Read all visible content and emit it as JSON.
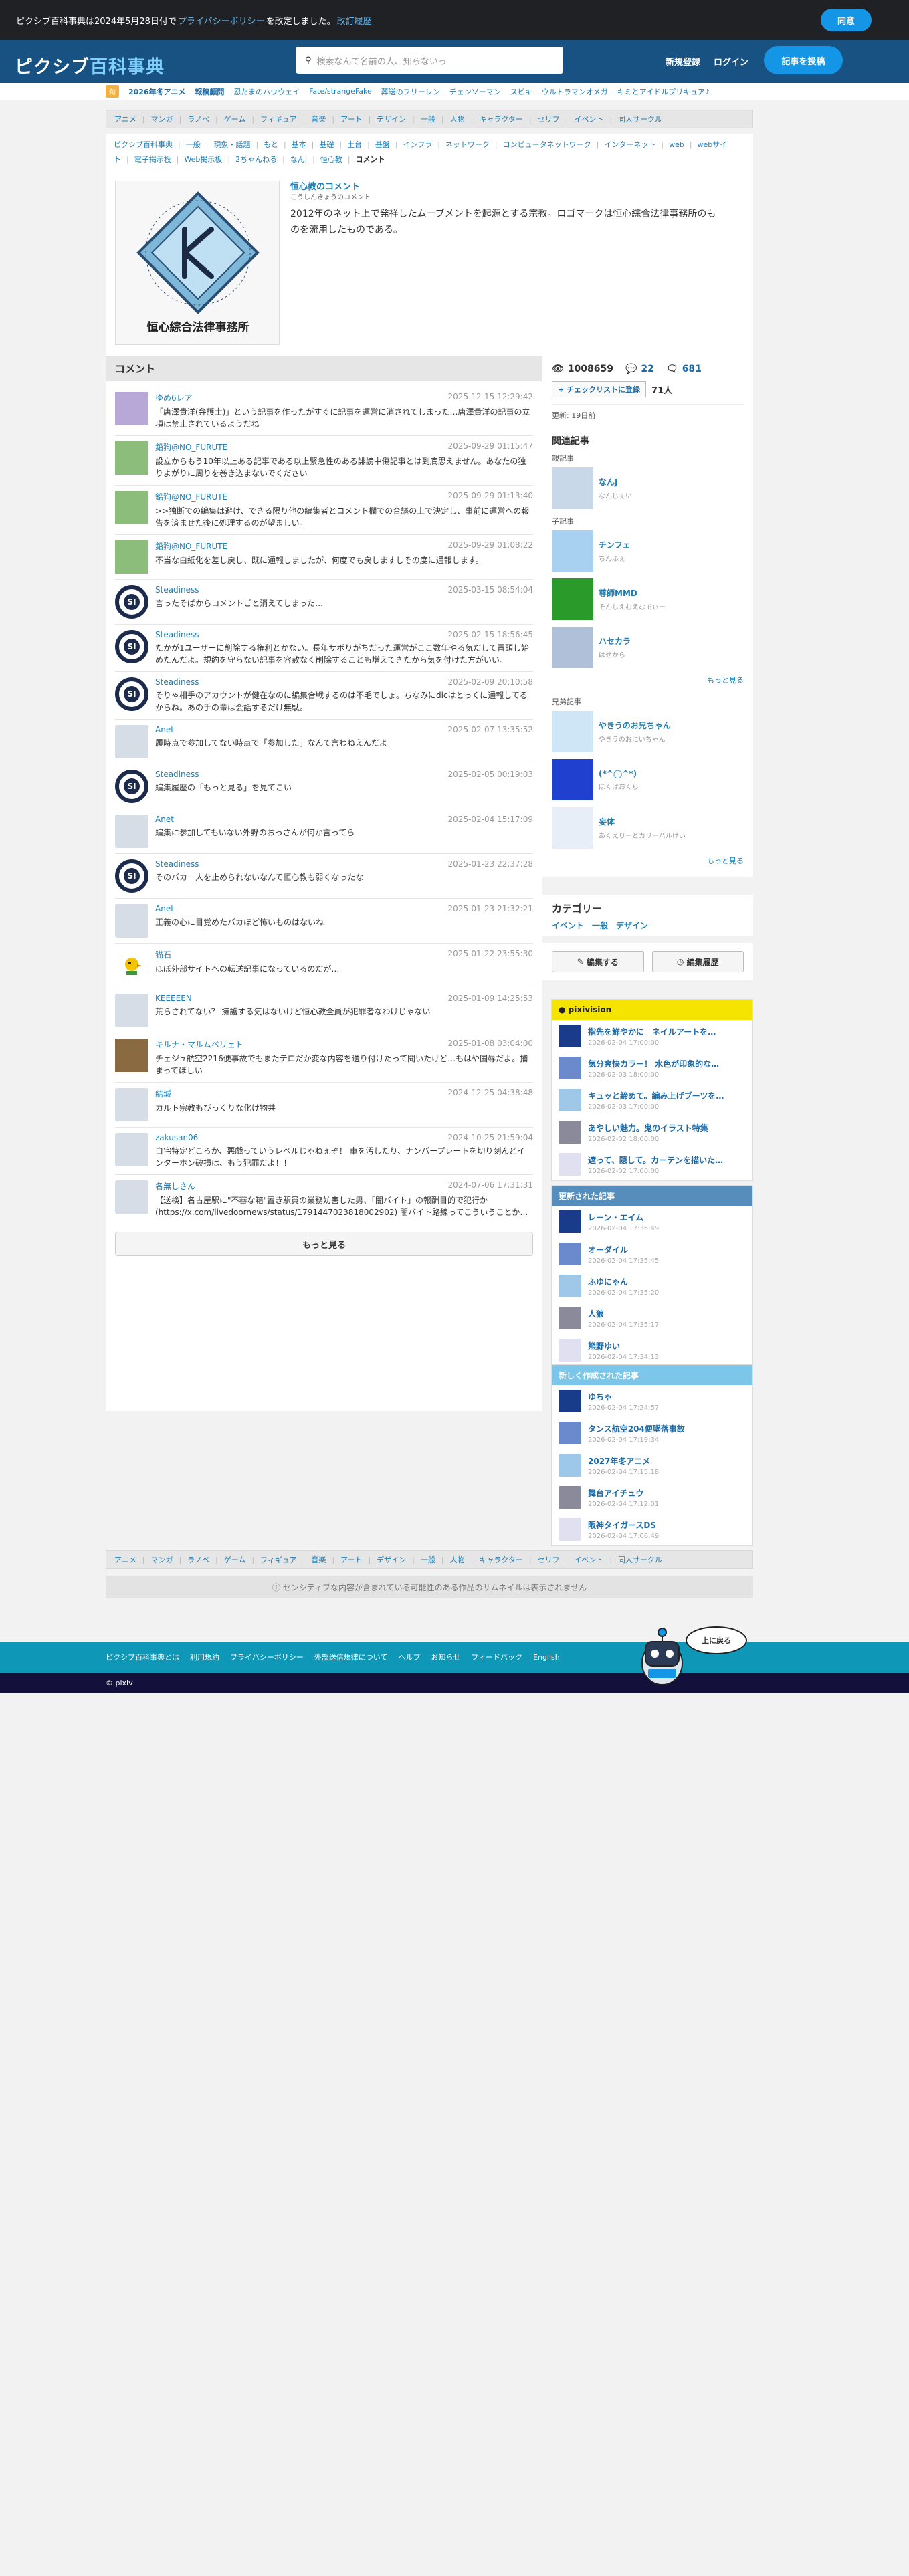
{
  "notice": {
    "pre": "ピクシブ百科事典は2024年5月28日付で",
    "link": "プライバシーポリシー",
    "post": "を改定しました。",
    "history": "改訂履歴",
    "agree": "同意"
  },
  "header": {
    "logo_a": "ピクシブ",
    "logo_b": "百科事典",
    "search_placeholder": "検索なんて名前の人、知らないっ",
    "signup": "新規登録",
    "login": "ログイン",
    "post": "記事を投稿"
  },
  "trend": {
    "badge": "旬",
    "items": [
      "2026年冬アニメ",
      "報稿顧問",
      "忍たまのハウウェイ",
      "Fate/strangeFake",
      "葬送のフリーレン",
      "チェンソーマン",
      "スピキ",
      "ウルトラマンオメガ",
      "キミとアイドルプリキュア♪"
    ]
  },
  "categories": [
    "アニメ",
    "マンガ",
    "ラノベ",
    "ゲーム",
    "フィギュア",
    "音楽",
    "アート",
    "デザイン",
    "一般",
    "人物",
    "キャラクター",
    "セリフ",
    "イベント",
    "同人サークル"
  ],
  "breadcrumbs": [
    "ピクシブ百科事典",
    "一般",
    "現象・話題",
    "もと",
    "基本",
    "基礎",
    "土台",
    "基盤",
    "インフラ",
    "ネットワーク",
    "コンピュータネットワーク",
    "インターネット",
    "web",
    "webサイト",
    "電子掲示板",
    "Web掲示板",
    "2ちゃんねる",
    "なんJ",
    "恒心教",
    "コメント"
  ],
  "article": {
    "title": "恒心教のコメント",
    "reading": "こうしんきょうのコメント",
    "desc": "2012年のネット上で発祥したムーブメントを起源とする宗教。ロゴマークは恒心綜合法律事務所のものを流用したものである。",
    "logo_caption": "恒心綜合法律事務所"
  },
  "comments": {
    "heading": "コメント",
    "more": "もっと見る",
    "items": [
      {
        "name": "ゆめ6レア",
        "date": "2025-12-15 12:29:42",
        "text": "「唐澤貴洋(弁護士)」という記事を作ったがすぐに記事を運営に消されてしまった…唐澤貴洋の記事の立項は禁止されているようだね",
        "av": "purple"
      },
      {
        "name": "鉛狗@NO_FURUTE",
        "date": "2025-09-29 01:15:47",
        "text": "設立からもう10年以上ある記事である以上緊急性のある誹謗中傷記事とは到底思えません。あなたの独りよがりに周りを巻き込まないでください",
        "av": "green"
      },
      {
        "name": "鉛狗@NO_FURUTE",
        "date": "2025-09-29 01:13:40",
        "text": ">>独断での編集は避け、できる限り他の編集者とコメント欄での合議の上で決定し、事前に運営への報告を済ませた後に処理するのが望ましい。",
        "av": "green"
      },
      {
        "name": "鉛狗@NO_FURUTE",
        "date": "2025-09-29 01:08:22",
        "text": "不当な白紙化を差し戻し、既に通報しましたが、何度でも戻しますしその度に通報します。",
        "av": "green"
      },
      {
        "name": "Steadiness",
        "date": "2025-03-15 08:54:04",
        "text": "言ったそばからコメントごと消えてしまった…",
        "av": "ring"
      },
      {
        "name": "Steadiness",
        "date": "2025-02-15 18:56:45",
        "text": "たかが1ユーザーに削除する権利とかない。長年サボりがちだった運営がここ数年やる気だして冒頭し始めたんだよ。規約を守らない記事を容赦なく削除することも増えてきたから気を付けた方がいい。",
        "av": "ring"
      },
      {
        "name": "Steadiness",
        "date": "2025-02-09 20:10:58",
        "text": "そりゃ相手のアカウントが健在なのに編集合戦するのは不毛でしょ。ちなみにdicはとっくに通報してるからね。あの手の輩は会話するだけ無駄。",
        "av": "ring"
      },
      {
        "name": "Anet",
        "date": "2025-02-07 13:35:52",
        "text": "履時点で参加してない時点で「参加した」なんて言わねえんだよ",
        "av": "blank"
      },
      {
        "name": "Steadiness",
        "date": "2025-02-05 00:19:03",
        "text": "編集履歴の「もっと見る」を見てこい",
        "av": "ring"
      },
      {
        "name": "Anet",
        "date": "2025-02-04 15:17:09",
        "text": "編集に参加してもいない外野のおっさんが何か言ってら",
        "av": "blank"
      },
      {
        "name": "Steadiness",
        "date": "2025-01-23 22:37:28",
        "text": "そのバカ一人を止められないなんて恒心教も弱くなったな",
        "av": "ring"
      },
      {
        "name": "Anet",
        "date": "2025-01-23 21:32:21",
        "text": "正義の心に目覚めたバカほど怖いものはないね",
        "av": "blank"
      },
      {
        "name": "猫石",
        "date": "2025-01-22 23:55:30",
        "text": "ほぼ外部サイトへの転送記事になっているのだが…",
        "av": "bird"
      },
      {
        "name": "KEEEEEN",
        "date": "2025-01-09 14:25:53",
        "text": "荒らされてない？ 擁護する気はないけど恒心教全員が犯罪者なわけじゃない",
        "av": "blank"
      },
      {
        "name": "キルナ・マルムベリェト",
        "date": "2025-01-08 03:04:00",
        "text": "チェジュ航空2216便事故でもまたテロだか変な内容を送り付けたって聞いたけど…もはや国辱だよ。捕まってほしい",
        "av": "brown"
      },
      {
        "name": "結城",
        "date": "2024-12-25 04:38:48",
        "text": "カルト宗教もびっくりな化け物共",
        "av": "blank"
      },
      {
        "name": "zakusan06",
        "date": "2024-10-25 21:59:04",
        "text": "自宅特定どころか、悪戯っていうレベルじゃねぇぞ！ 車を汚したり、ナンバープレートを切り刻んどインターホン破損は、もう犯罪だよ！！",
        "av": "blank"
      },
      {
        "name": "名無しさん",
        "date": "2024-07-06 17:31:31",
        "text": "【送検】名古屋駅に\"不審な箱\"置き駅員の業務妨害した男、「闇バイト」の報酬目的で犯行か(https://x.com/livedoornews/status/1791447023818002902) 闇バイト路線ってこういうことか…",
        "av": "blank"
      }
    ]
  },
  "sidebar": {
    "views": "1008659",
    "comments": "22",
    "edits": "681",
    "checklist": "チェックリストに登録",
    "check_count": "71人",
    "updated": "更新: 19日前",
    "related": "関連記事",
    "sub_parent": "親記事",
    "sub_child": "子記事",
    "sub_sibling": "兄弟記事",
    "parent": [
      {
        "name": "なんJ",
        "sub": "なんじぇい"
      }
    ],
    "child": [
      {
        "name": "チンフェ",
        "sub": "ちんふぇ"
      },
      {
        "name": "尊師MMD",
        "sub": "そんしえむえむでぃー"
      },
      {
        "name": "ハセカラ",
        "sub": "はせから"
      }
    ],
    "sibling": [
      {
        "name": "やきうのお兄ちゃん",
        "sub": "やきうのおにいちゃん"
      },
      {
        "name": "(*^◯^*)",
        "sub": "ぼくはおくら"
      },
      {
        "name": "妄体",
        "sub": "あくえりーとカリーバルけい"
      }
    ],
    "more": "もっと見る",
    "category_head": "カテゴリー",
    "category_links": [
      "イベント",
      "一般",
      "デザイン"
    ],
    "edit": "編集する",
    "history": "編集履歴",
    "pixivision_head": "pixivision",
    "pixivision": [
      {
        "title": "指先を鮮やかに　ネイルアートを…",
        "date": "2026-02-04 17:00:00"
      },
      {
        "title": "気分爽快カラー！ 水色が印象的な…",
        "date": "2026-02-03 18:00:00"
      },
      {
        "title": "キュッと締めて。編み上げブーツを…",
        "date": "2026-02-03 17:00:00"
      },
      {
        "title": "あやしい魅力。鬼のイラスト特集",
        "date": "2026-02-02 18:00:00"
      },
      {
        "title": "遮って、隠して。カーテンを描いた…",
        "date": "2026-02-02 17:00:00"
      }
    ],
    "updated_head": "更新された記事",
    "updated_items": [
      {
        "title": "レーン・エイム",
        "date": "2026-02-04 17:35:49"
      },
      {
        "title": "オーダイル",
        "date": "2026-02-04 17:35:45"
      },
      {
        "title": "ふゆにゃん",
        "date": "2026-02-04 17:35:20"
      },
      {
        "title": "人狼",
        "date": "2026-02-04 17:35:17"
      },
      {
        "title": "熊野ゆい",
        "date": "2026-02-04 17:34:13"
      }
    ],
    "new_head": "新しく作成された記事",
    "new_items": [
      {
        "title": "ゆちゃ",
        "date": "2026-02-04 17:24:57"
      },
      {
        "title": "タンス航空204便墜落事故",
        "date": "2026-02-04 17:19:34"
      },
      {
        "title": "2027年冬アニメ",
        "date": "2026-02-04 17:15:18"
      },
      {
        "title": "舞台アイチュウ",
        "date": "2026-02-04 17:12:01"
      },
      {
        "title": "阪神タイガースDS",
        "date": "2026-02-04 17:06:49"
      }
    ]
  },
  "sensitive": "センシティブな内容が含まれている可能性のある作品のサムネイルは表示されません",
  "footer": {
    "links": [
      "ピクシブ百科事典とは",
      "利用規約",
      "プライバシーポリシー",
      "外部送信規律について",
      "ヘルプ",
      "お知らせ",
      "フィードバック",
      "English"
    ],
    "copyright": "© pixiv",
    "totop": "上に戻る"
  }
}
